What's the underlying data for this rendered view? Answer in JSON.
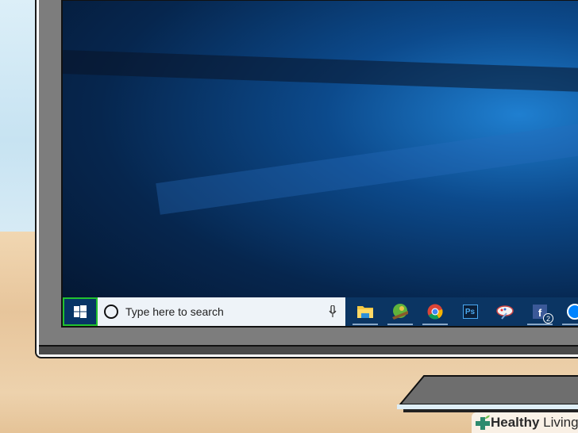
{
  "taskbar": {
    "start_icon": "windows-logo-icon",
    "search_placeholder": "Type here to search",
    "search_icon": "cortana-circle-icon",
    "mic_icon": "microphone-icon",
    "apps": [
      {
        "name": "file-explorer",
        "icon": "folder-icon"
      },
      {
        "name": "game-app",
        "icon": "game-icon"
      },
      {
        "name": "chrome",
        "icon": "chrome-icon"
      },
      {
        "name": "photoshop",
        "icon": "photoshop-icon",
        "label": "Ps"
      },
      {
        "name": "paint-app",
        "icon": "paint-icon"
      },
      {
        "name": "facebook",
        "icon": "facebook-icon",
        "label": "f",
        "badge": "2"
      },
      {
        "name": "messenger",
        "icon": "messenger-icon"
      }
    ]
  },
  "watermark": {
    "word1": "Healthy",
    "word2": "Living"
  },
  "colors": {
    "taskbar": "#0b3563",
    "start_highlight": "#22c22e",
    "search_bg": "#eef3f8"
  }
}
